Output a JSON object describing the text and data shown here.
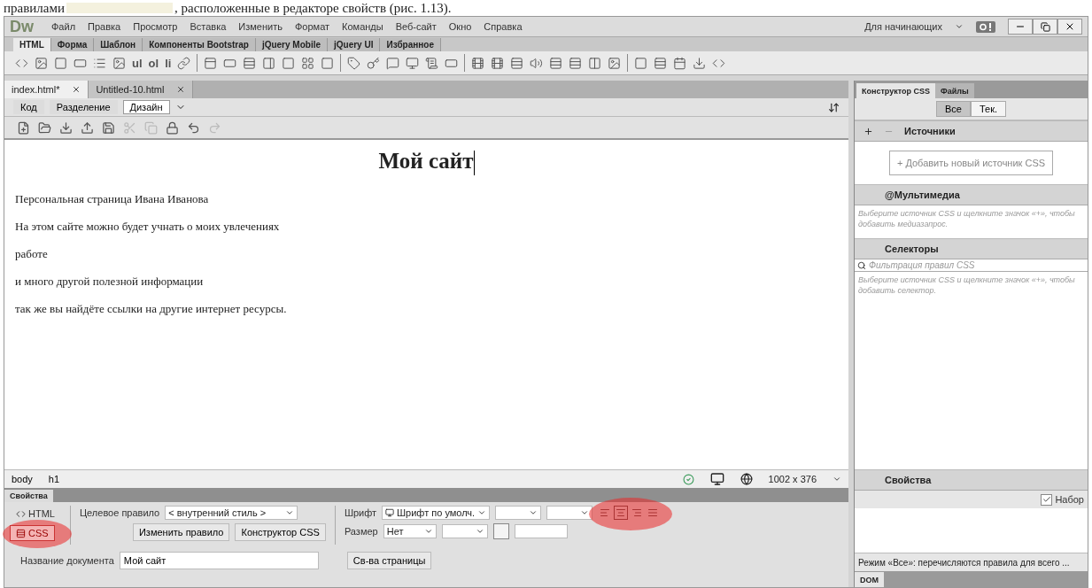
{
  "caption": {
    "before": "правилами",
    "after": ", расположенные в редакторе свойств (рис. 1.13)."
  },
  "menu": {
    "logo": "Dw",
    "items": [
      "Файл",
      "Правка",
      "Просмотр",
      "Вставка",
      "Изменить",
      "Формат",
      "Команды",
      "Веб-сайт",
      "Окно",
      "Справка"
    ],
    "workspace": "Для начинающих"
  },
  "insert_tabs": [
    {
      "label": "HTML",
      "selected": true
    },
    {
      "label": "Форма",
      "selected": false
    },
    {
      "label": "Шаблон",
      "selected": false
    },
    {
      "label": "Компоненты Bootstrap",
      "selected": false
    },
    {
      "label": "jQuery Mobile",
      "selected": false
    },
    {
      "label": "jQuery UI",
      "selected": false
    },
    {
      "label": "Избранное",
      "selected": false
    }
  ],
  "insert_toolbar": [
    {
      "kind": "icon"
    },
    {
      "kind": "icon"
    },
    {
      "kind": "icon"
    },
    {
      "kind": "icon"
    },
    {
      "kind": "icon"
    },
    {
      "kind": "icon"
    },
    {
      "kind": "text",
      "label": "ul"
    },
    {
      "kind": "text",
      "label": "ol"
    },
    {
      "kind": "text",
      "label": "li"
    },
    {
      "kind": "icon"
    },
    {
      "kind": "separator"
    },
    {
      "kind": "icon"
    },
    {
      "kind": "icon"
    },
    {
      "kind": "icon"
    },
    {
      "kind": "icon"
    },
    {
      "kind": "icon"
    },
    {
      "kind": "icon"
    },
    {
      "kind": "icon"
    },
    {
      "kind": "separator"
    },
    {
      "kind": "icon"
    },
    {
      "kind": "icon"
    },
    {
      "kind": "icon"
    },
    {
      "kind": "icon"
    },
    {
      "kind": "icon"
    },
    {
      "kind": "icon"
    },
    {
      "kind": "separator"
    },
    {
      "kind": "icon"
    },
    {
      "kind": "icon"
    },
    {
      "kind": "icon"
    },
    {
      "kind": "icon"
    },
    {
      "kind": "icon"
    },
    {
      "kind": "icon"
    },
    {
      "kind": "icon"
    },
    {
      "kind": "icon"
    },
    {
      "kind": "separator"
    },
    {
      "kind": "icon"
    },
    {
      "kind": "icon"
    },
    {
      "kind": "icon"
    },
    {
      "kind": "icon"
    },
    {
      "kind": "icon"
    }
  ],
  "doc_tabs": [
    {
      "label": "index.html*",
      "selected": true
    },
    {
      "label": "Untitled-10.html",
      "selected": false
    }
  ],
  "view_buttons": [
    {
      "label": "Код",
      "selected": false
    },
    {
      "label": "Разделение",
      "selected": false
    },
    {
      "label": "Дизайн",
      "selected": true
    }
  ],
  "document": {
    "heading": "Мой сайт",
    "paragraphs": [
      "Персональная страница Ивана Иванова",
      "На этом сайте можно будет учнать о моих увлечениях",
      "работе",
      "и много другой полезной информации",
      "так же вы найдёте ссылки на другие интернет ресурсы."
    ]
  },
  "tag_selector": [
    "body",
    "h1"
  ],
  "window_size": "1002 x 376",
  "properties": {
    "title": "Свойства",
    "modes": [
      {
        "label": "HTML",
        "selected": false,
        "highlighted": false
      },
      {
        "label": "CSS",
        "selected": true,
        "highlighted": true
      }
    ],
    "target_rule_label": "Целевое правило",
    "target_rule": "< внутренний стиль >",
    "edit_rule": "Изменить правило",
    "css_designer": "Конструктор CSS",
    "font_label": "Шрифт",
    "font": "Шрифт по умолч.",
    "size_label": "Размер",
    "size": "Нет",
    "align": {
      "highlighted": true,
      "buttons": [
        {
          "selected": false
        },
        {
          "selected": true
        },
        {
          "selected": false
        },
        {
          "selected": false
        }
      ]
    },
    "doc_title_label": "Название документа",
    "doc_title": "Мой сайт",
    "page_props": "Св-ва страницы"
  },
  "css_panel": {
    "tabs": [
      {
        "label": "Конструктор CSS",
        "selected": true
      },
      {
        "label": "Файлы",
        "selected": false
      }
    ],
    "filter": [
      {
        "label": "Все",
        "selected": true
      },
      {
        "label": "Тек.",
        "selected": false
      }
    ],
    "sources": "Источники",
    "add_source": "+ Добавить новый источник CSS",
    "media": "@Мультимедиа",
    "media_hint": "Выберите источник CSS и щелкните значок «+», чтобы добавить медиазапрос.",
    "selectors": "Селекторы",
    "selector_filter_placeholder": "Фильтрация правил CSS",
    "selectors_hint": "Выберите источник CSS и щелкните значок «+», чтобы добавить селектор.",
    "properties": "Свойства",
    "show_set_label": "Набор",
    "show_set": true,
    "status": "Режим «Все»: перечисляются правила для всего ...",
    "dom_tab": "DOM"
  }
}
